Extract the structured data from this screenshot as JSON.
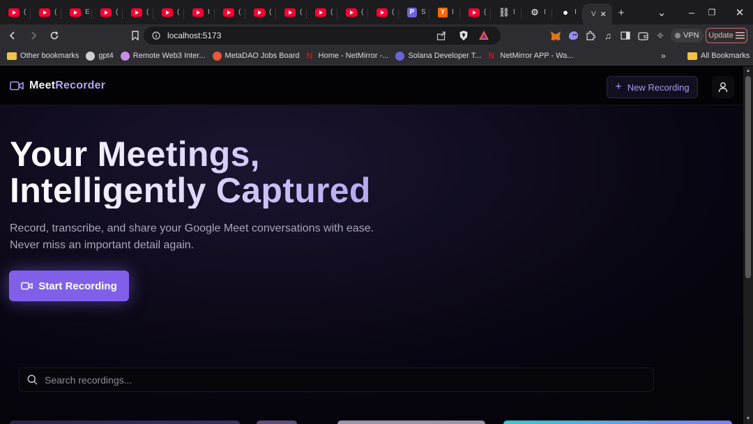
{
  "browser": {
    "tabs": [
      {
        "type": "youtube",
        "label": "("
      },
      {
        "type": "youtube",
        "label": "("
      },
      {
        "type": "youtube",
        "label": "E"
      },
      {
        "type": "youtube",
        "label": "("
      },
      {
        "type": "youtube",
        "label": "("
      },
      {
        "type": "youtube",
        "label": "("
      },
      {
        "type": "youtube",
        "label": "I"
      },
      {
        "type": "youtube",
        "label": "("
      },
      {
        "type": "youtube",
        "label": "("
      },
      {
        "type": "youtube",
        "label": "("
      },
      {
        "type": "youtube",
        "label": "("
      },
      {
        "type": "youtube",
        "label": "("
      },
      {
        "type": "youtube",
        "label": "("
      },
      {
        "type": "p",
        "label": "S"
      },
      {
        "type": "y",
        "label": "I"
      },
      {
        "type": "youtube",
        "label": "("
      },
      {
        "type": "link",
        "label": "I"
      },
      {
        "type": "puzzle",
        "label": "I"
      },
      {
        "type": "github",
        "label": "I"
      },
      {
        "type": "active",
        "label": "V"
      }
    ],
    "url": "localhost:5173",
    "vpn_label": "VPN",
    "update_label": "Update",
    "bookmarks": [
      {
        "label": "Other bookmarks",
        "icon": "folder-icon"
      },
      {
        "label": "gpt4",
        "icon": "globe-icon"
      },
      {
        "label": "Remote Web3 Inter...",
        "icon": "unicorn-icon"
      },
      {
        "label": "MetaDAO Jobs Board",
        "icon": "ladybug-icon"
      },
      {
        "label": "Home - NetMirror -...",
        "icon": "netmirror-icon"
      },
      {
        "label": "Solana Developer T...",
        "icon": "solana-icon"
      },
      {
        "label": "NetMirror APP - Wa...",
        "icon": "netmirror-icon"
      }
    ],
    "all_bookmarks": "All Bookmarks"
  },
  "app": {
    "brand_part1": "Meet",
    "brand_part2": "Recorder",
    "new_recording_label": "New Recording",
    "hero": {
      "title_line1": "Your Meetings,",
      "title_line2": "Intelligently Captured",
      "subtitle_line1": "Record, transcribe, and share your Google Meet conversations with ease.",
      "subtitle_line2": "Never miss an important detail again."
    },
    "start_recording_label": "Start Recording",
    "search_placeholder": "Search recordings...",
    "colors": {
      "accent": "#8060e8",
      "accent_text": "#a99af2"
    }
  }
}
